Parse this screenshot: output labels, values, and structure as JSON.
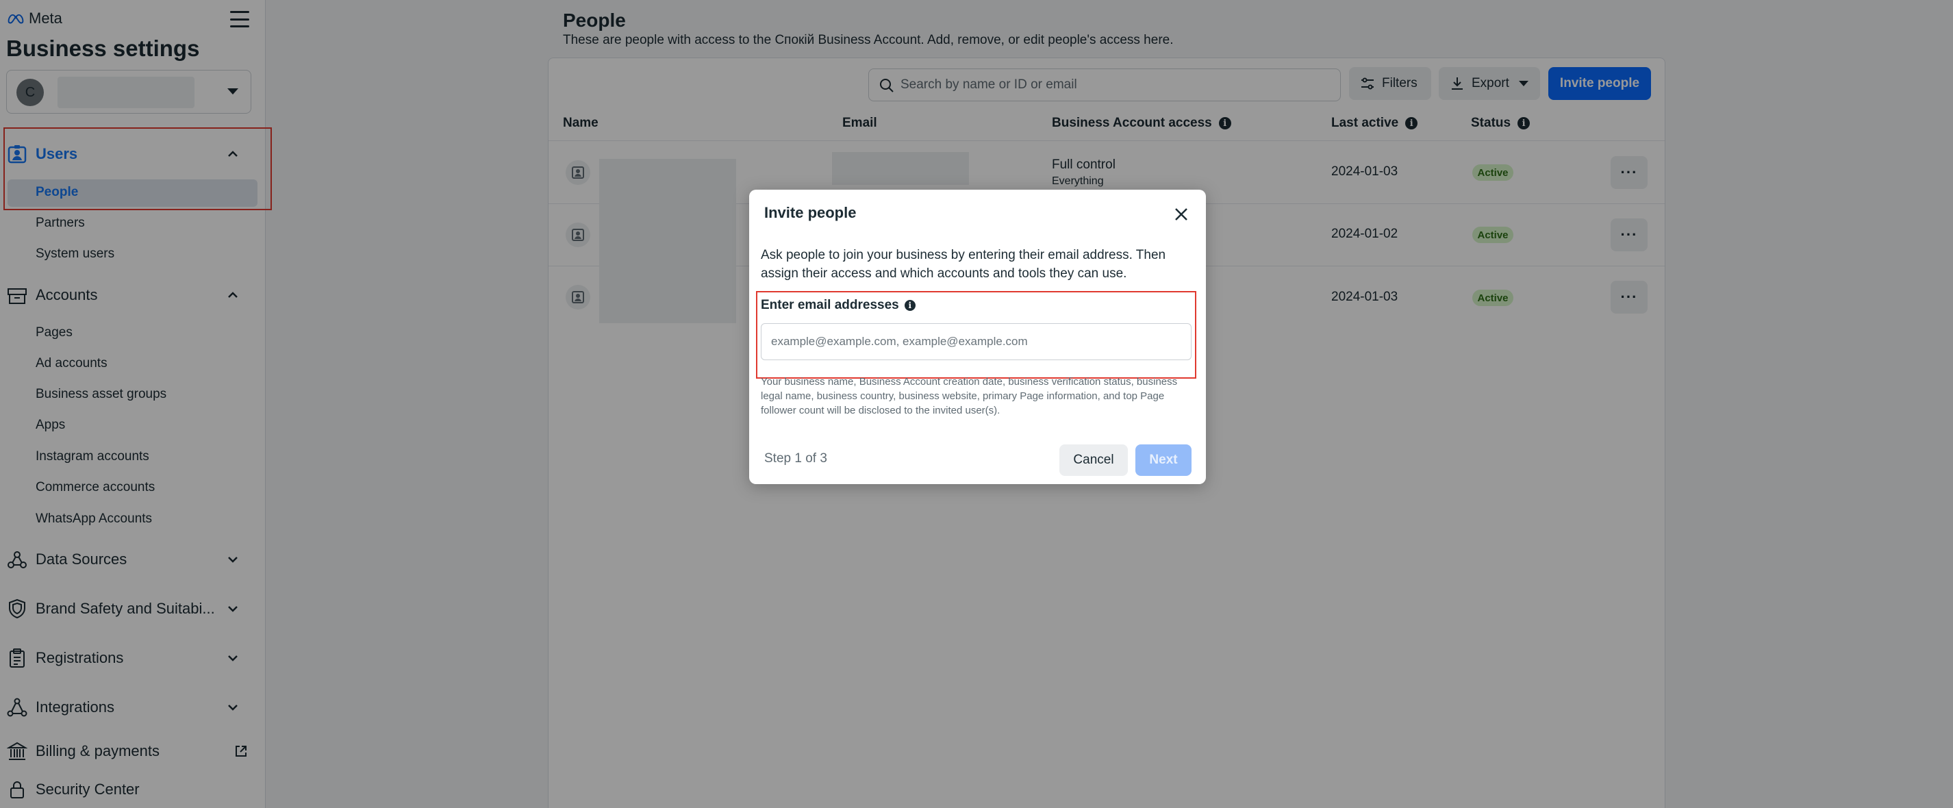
{
  "sidebar": {
    "brand": "Meta",
    "title": "Business settings",
    "account": {
      "avatar_letter": "C"
    },
    "sections": {
      "users": {
        "label": "Users",
        "items": [
          "People",
          "Partners",
          "System users"
        ]
      },
      "accounts": {
        "label": "Accounts",
        "items": [
          "Pages",
          "Ad accounts",
          "Business asset groups",
          "Apps",
          "Instagram accounts",
          "Commerce accounts",
          "WhatsApp Accounts"
        ]
      },
      "data_sources": {
        "label": "Data Sources"
      },
      "brand_safety": {
        "label": "Brand Safety and Suitabi..."
      },
      "registrations": {
        "label": "Registrations"
      },
      "integrations": {
        "label": "Integrations"
      },
      "billing": {
        "label": "Billing & payments"
      },
      "security": {
        "label": "Security Center"
      }
    }
  },
  "main": {
    "title": "People",
    "subtitle": "These are people with access to the Спокій Business Account. Add, remove, or edit people's access here.",
    "search_placeholder": "Search by name or ID or email",
    "filters_label": "Filters",
    "export_label": "Export",
    "invite_label": "Invite people",
    "columns": {
      "name": "Name",
      "email": "Email",
      "access": "Business Account access",
      "last_active": "Last active",
      "status": "Status"
    },
    "rows": [
      {
        "access": "Full control",
        "access_detail": "Everything",
        "last_active": "2024-01-03",
        "status": "Active"
      },
      {
        "last_active": "2024-01-02",
        "status": "Active"
      },
      {
        "last_active": "2024-01-03",
        "status": "Active"
      }
    ],
    "more_label": "···"
  },
  "dialog": {
    "title": "Invite people",
    "description": "Ask people to join your business by entering their email address. Then assign their access and which accounts and tools they can use.",
    "email_label": "Enter email addresses",
    "info_glyph": "i",
    "email_placeholder": "example@example.com, example@example.com",
    "disclaimer": "Your business name, Business Account creation date, business verification status, business legal name, business country, business website, primary Page information, and top Page follower count will be disclosed to the invited user(s).",
    "step": "Step 1 of 3",
    "cancel_label": "Cancel",
    "next_label": "Next"
  },
  "colors": {
    "accent": "#0a6cff",
    "highlight": "#e0392f",
    "status_active": "#d5f3c9"
  }
}
